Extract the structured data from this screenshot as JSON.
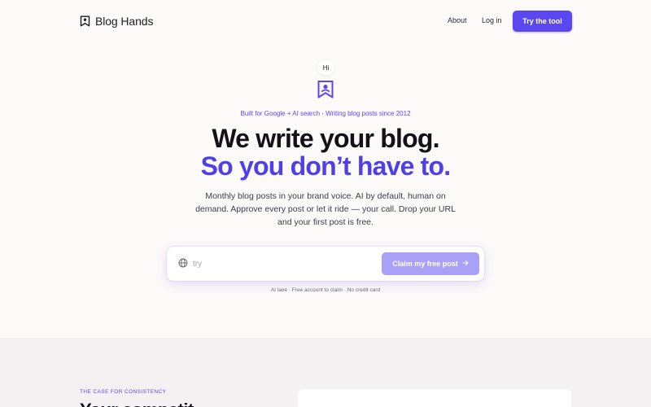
{
  "nav": {
    "brand": "Blog Hands",
    "about": "About",
    "login": "Log in",
    "cta": "Try the tool"
  },
  "hero": {
    "bubble": "Hi",
    "eyebrow": "Built for Google + AI search · Writing blog posts since 2012",
    "headline_line1": "We write your blog.",
    "headline_line2": "So you don’t have to.",
    "subtext": "Monthly blog posts in your brand voice. AI by default, human on demand. Approve every post or let it ride — your call. Drop your URL and your first post is free."
  },
  "form": {
    "url_value": "",
    "url_placeholder": "try",
    "button_label": "Claim my free post",
    "fineprint": "AI lane · Free account to claim · No credit card"
  },
  "section2": {
    "eyebrow": "THE CASE FOR CONSISTENCY",
    "heading": "Your competit"
  },
  "colors": {
    "accent": "#5b47f0",
    "accent_light": "#a9a1f7",
    "background": "#fcf9f9",
    "section_bg": "#f3f1f1"
  },
  "icons": {
    "brand": "bookmark-user-icon",
    "hero": "bookmark-user-icon",
    "url": "globe-icon",
    "button": "arrow-right-icon"
  }
}
